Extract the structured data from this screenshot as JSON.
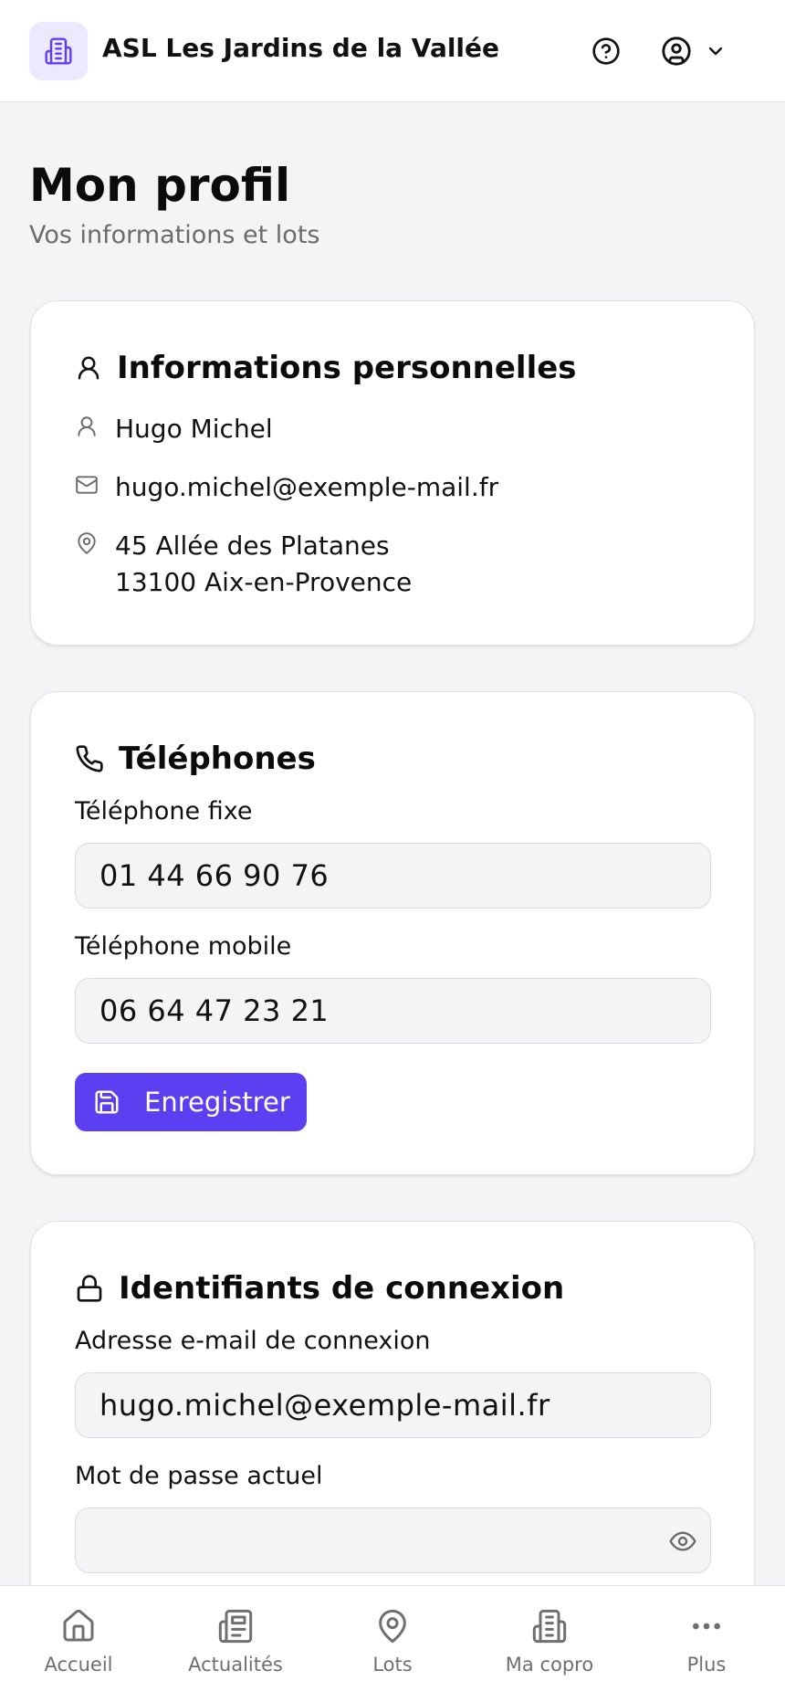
{
  "header": {
    "title": "ASL Les Jardins de la Vallée",
    "logo_icon": "building-icon",
    "help_icon": "help-circle-icon",
    "account_icon": "user-circle-icon",
    "account_menu_icon": "chevron-down-icon"
  },
  "page": {
    "title": "Mon profil",
    "subtitle": "Vos informations et lots"
  },
  "personal_info": {
    "title": "Informations personnelles",
    "name": "Hugo Michel",
    "email": "hugo.michel@exemple-mail.fr",
    "address_line1": "45 Allée des Platanes",
    "address_line2": "13100 Aix-en-Provence"
  },
  "phones": {
    "title": "Téléphones",
    "landline_label": "Téléphone fixe",
    "landline_value": "01 44 66 90 76",
    "mobile_label": "Téléphone mobile",
    "mobile_value": "06 64 47 23 21",
    "save_label": "Enregistrer"
  },
  "credentials": {
    "title": "Identifiants de connexion",
    "email_label": "Adresse e-mail de connexion",
    "email_value": "hugo.michel@exemple-mail.fr",
    "password_label": "Mot de passe actuel",
    "password_value": ""
  },
  "bottom_nav": {
    "items": [
      {
        "label": "Accueil",
        "icon": "home-icon"
      },
      {
        "label": "Actualités",
        "icon": "newspaper-icon"
      },
      {
        "label": "Lots",
        "icon": "map-pin-icon"
      },
      {
        "label": "Ma copro",
        "icon": "building-icon"
      },
      {
        "label": "Plus",
        "icon": "more-horizontal-icon"
      }
    ]
  },
  "colors": {
    "accent": "#5b3ff0",
    "accent_light": "#ece9fe",
    "background": "#f3f4f6",
    "text": "#111111",
    "muted": "#6b6b6b"
  }
}
